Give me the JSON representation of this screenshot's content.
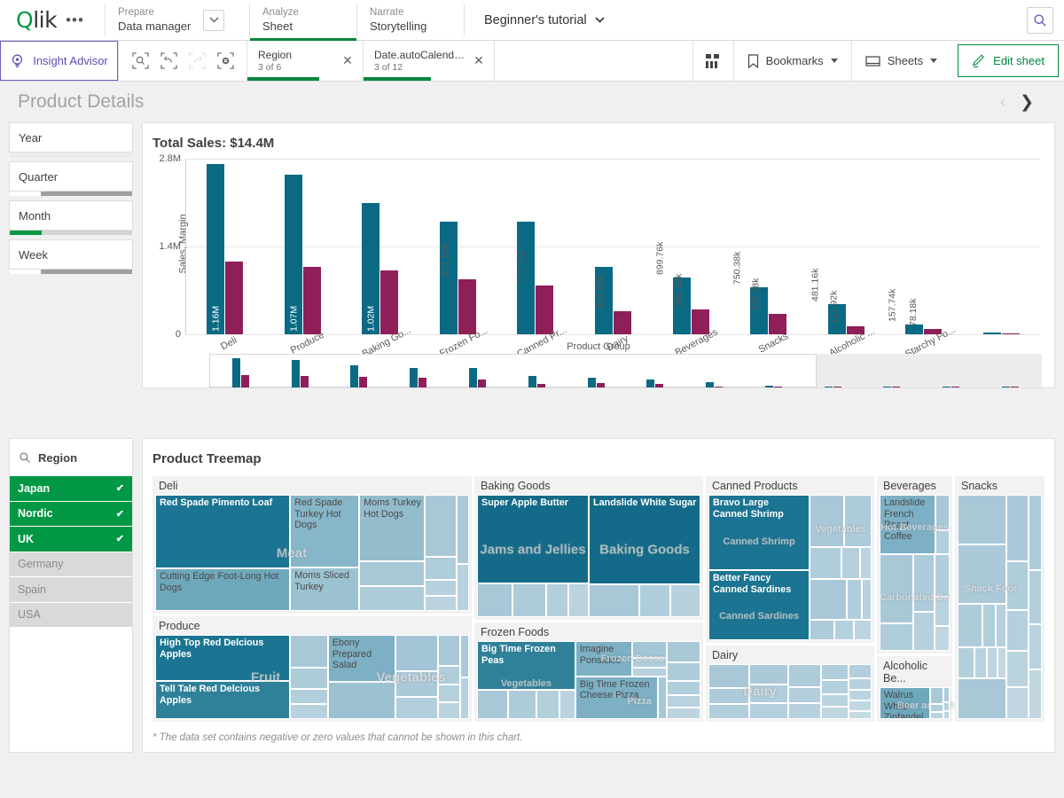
{
  "topbar": {
    "logo": "Qlik",
    "more_icon": "ellipsis-icon",
    "nav": [
      {
        "over": "Prepare",
        "main": "Data manager",
        "active": false
      },
      {
        "over": "Analyze",
        "main": "Sheet",
        "active": true
      },
      {
        "over": "Narrate",
        "main": "Storytelling",
        "active": false
      }
    ],
    "app_title": "Beginner's tutorial",
    "search_icon": "search-icon"
  },
  "selbar": {
    "insight_advisor": "Insight Advisor",
    "tools": [
      {
        "name": "selection-search-icon",
        "disabled": false
      },
      {
        "name": "step-back-icon",
        "disabled": false
      },
      {
        "name": "step-forward-icon",
        "disabled": true
      },
      {
        "name": "clear-all-selections-icon",
        "disabled": false
      }
    ],
    "chips": [
      {
        "field": "Region",
        "state": "3 of 6",
        "fill_pct": 62
      },
      {
        "field": "Date.autoCalendar....",
        "state": "3 of 12",
        "fill_pct": 52
      }
    ],
    "grid_icon": "sheet-grid-icon",
    "bookmarks": "Bookmarks",
    "sheets": "Sheets",
    "edit_sheet": "Edit sheet"
  },
  "sheet": {
    "title": "Product Details",
    "prev_icon": "chevron-left-icon",
    "next_icon": "chevron-right-icon"
  },
  "filters": [
    {
      "label": "Year",
      "fill_pct": 0,
      "fill_color": "#d4d4d4",
      "track": "#ececec"
    },
    {
      "label": "Quarter",
      "fill_pct": 25,
      "fill_color": "#ffffff",
      "track": "#9e9e9e"
    },
    {
      "label": "Month",
      "fill_pct": 26,
      "fill_color": "#009845",
      "track": "#d4d4d4"
    },
    {
      "label": "Week",
      "fill_pct": 25,
      "fill_color": "#ffffff",
      "track": "#9e9e9e"
    }
  ],
  "barchart": {
    "title": "Total Sales: $14.4M"
  },
  "chart_data": {
    "type": "bar",
    "title": "Total Sales: $14.4M",
    "xlabel": "Product Group",
    "ylabel": "Sales, Margin",
    "ylim": [
      0,
      2.8
    ],
    "yticks": [
      "0",
      "1.4M",
      "2.8M"
    ],
    "grid": true,
    "categories": [
      "Deli",
      "Produce",
      "Baking Go...",
      "Frozen Fo...",
      "Canned Pr...",
      "Dairy",
      "Beverages",
      "Snacks",
      "Alcoholic ...",
      "Starchy Fo...",
      ""
    ],
    "series": [
      {
        "name": "Sales",
        "color": "#0a6a84",
        "labels": [
          "2.72M",
          "2.54M",
          "2.09M",
          "1.8M",
          "1.79M",
          "1.07M",
          "899.76k",
          "750.38k",
          "481.16k",
          "157.74k",
          ""
        ],
        "values": [
          2.72,
          2.54,
          2.09,
          1.8,
          1.79,
          1.07,
          0.89976,
          0.75038,
          0.48116,
          0.15774,
          0.03
        ]
      },
      {
        "name": "Margin",
        "color": "#8e1f59",
        "labels": [
          "1.16M",
          "1.07M",
          "1.02M",
          "871.35k",
          "777.74k",
          "364.85k",
          "391.39k",
          "325.38k",
          "121.92k",
          "78.18k",
          ""
        ],
        "values": [
          1.16,
          1.07,
          1.02,
          0.87135,
          0.77774,
          0.36485,
          0.39139,
          0.32538,
          0.12192,
          0.07818,
          0.012
        ]
      }
    ]
  },
  "region": {
    "title": "Region",
    "search_icon": "search-icon",
    "items": [
      {
        "label": "Japan",
        "state": "selected"
      },
      {
        "label": "Nordic",
        "state": "selected"
      },
      {
        "label": "UK",
        "state": "selected"
      },
      {
        "label": "Germany",
        "state": "excluded"
      },
      {
        "label": "Spain",
        "state": "excluded"
      },
      {
        "label": "USA",
        "state": "excluded"
      }
    ]
  },
  "treemap": {
    "title": "Product Treemap",
    "footnote": "* The data set contains negative or zero values that cannot be shown in this chart.",
    "groups": {
      "deli": "Deli",
      "produce": "Produce",
      "baking": "Baking Goods",
      "frozen": "Frozen Foods",
      "canned": "Canned Products",
      "dairy": "Dairy",
      "beverages": "Beverages",
      "alcoholic": "Alcoholic Be...",
      "snacks": "Snacks"
    },
    "tiles": {
      "red_spade_pimento": "Red Spade Pimento Loaf",
      "cutting_edge_hotdogs": "Cutting Edge Foot-Long Hot Dogs",
      "red_spade_turkey": "Red Spade Turkey Hot Dogs",
      "moms_sliced_turkey": "Moms Sliced Turkey",
      "moms_turkey_hotdogs": "Moms Turkey Hot Dogs",
      "high_top_apples": "High Top Red Delcious Apples",
      "tell_tale_apples": "Tell Tale Red Delcious Apples",
      "ebony_salad": "Ebony Prepared Salad",
      "super_apple_butter": "Super Apple Butter",
      "landslide_sugar": "Landslide White Sugar",
      "big_time_peas": "Big Time Frozen Peas",
      "imagine_ponsicles": "Imagine Ponsicles",
      "big_time_pizza": "Big Time Frozen Cheese Pizza",
      "bravo_shrimp": "Bravo Large Canned Shrimp",
      "better_sardines": "Better Fancy Canned Sardines",
      "landslide_coffee": "Landslide French Roast Coffee",
      "walrus_zinfandel": "Walrus White Zinfandel Wine"
    },
    "overlays": {
      "meat": "Meat",
      "fruit": "Fruit",
      "vegetables": "Vegetables",
      "jams": "Jams and Jellies",
      "baking_goods": "Baking Goods",
      "frozen_desserts": "Frozen Desserts",
      "pizza": "Pizza",
      "canned_shrimp": "Canned Shrimp",
      "canned_sardines": "Canned Sardines",
      "dairy": "Dairy",
      "hot_beverages": "Hot Beverages",
      "carbonated": "Carbonated Bev...",
      "beer_wine": "Beer and Wine",
      "snack_foods": "Snack Foods"
    }
  },
  "colors": {
    "qlik_green": "#009845",
    "accent_green": "#00873d",
    "purple": "#5a4bb5",
    "bar_teal": "#0a6a84",
    "bar_magenta": "#8e1f59",
    "tree_dark": "#1b7491",
    "tree_mid": "#6ea8bd",
    "tree_light": "#a8c8d8"
  }
}
